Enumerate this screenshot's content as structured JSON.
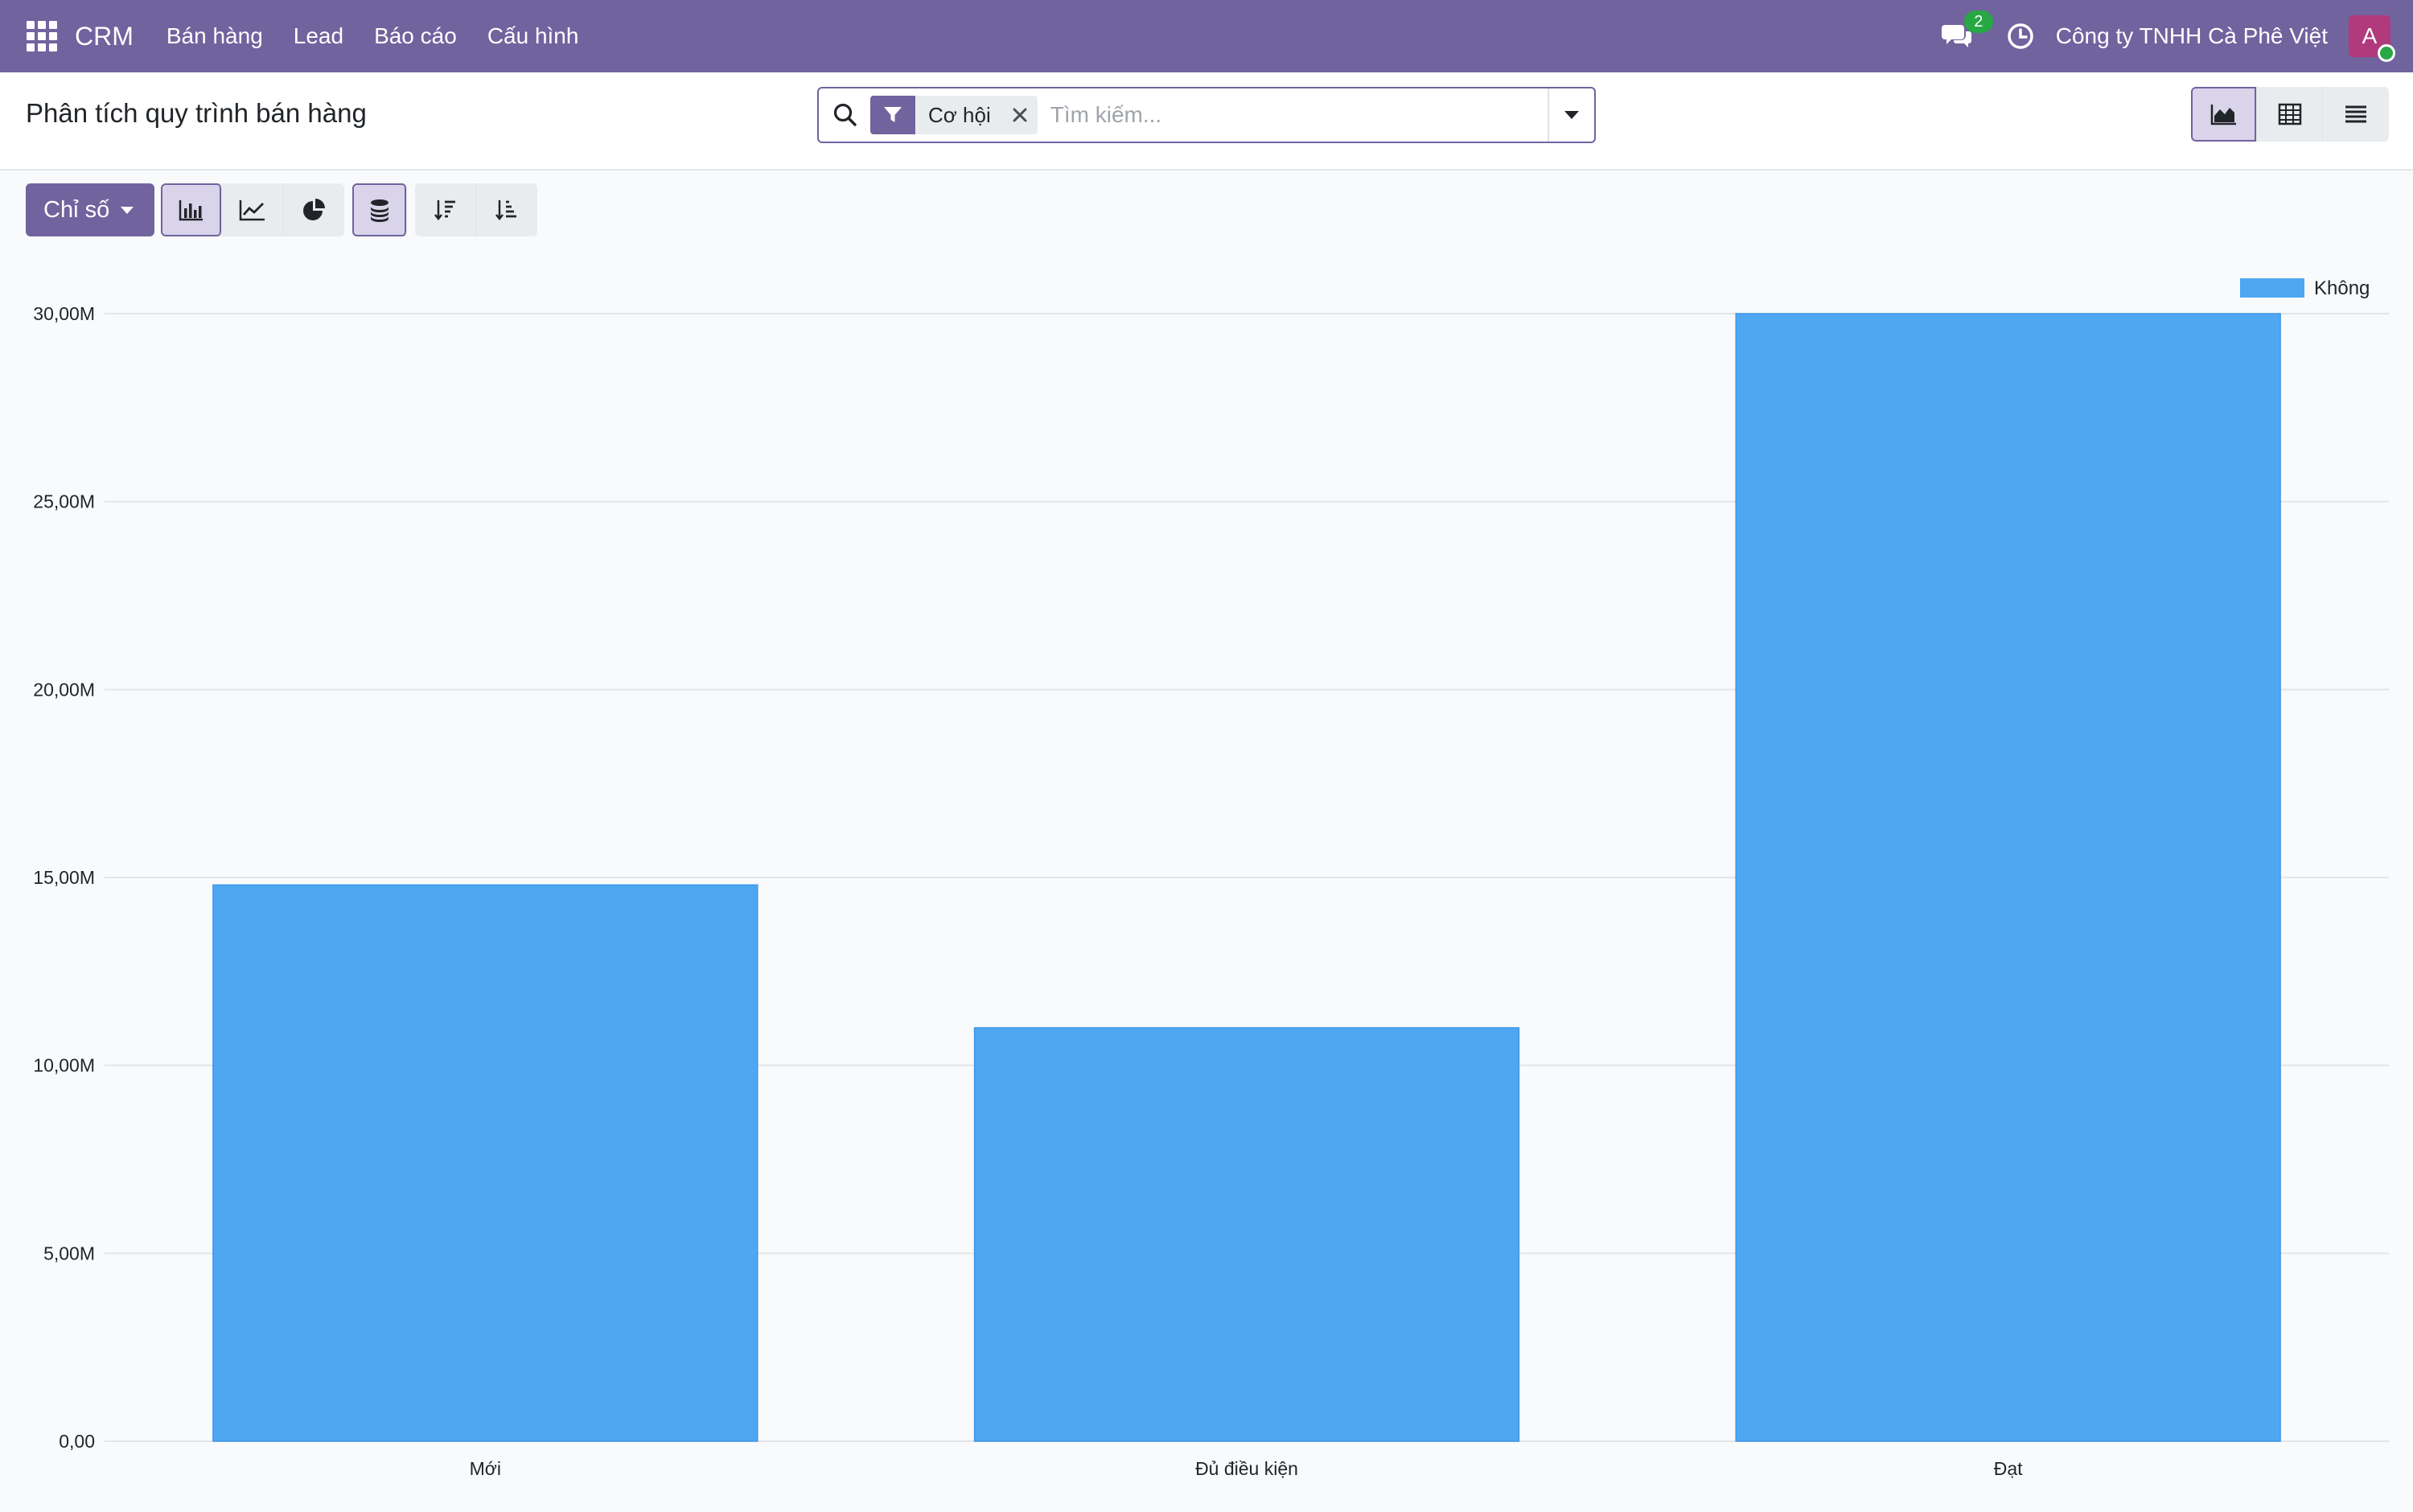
{
  "navbar": {
    "brand": "CRM",
    "menu": [
      "Bán hàng",
      "Lead",
      "Báo cáo",
      "Cấu hình"
    ],
    "chat_count": "2",
    "company": "Công ty TNHH Cà Phê Việt",
    "avatar_letter": "A"
  },
  "control_panel": {
    "title": "Phân tích quy trình bán hàng",
    "search": {
      "facet_label": "Cơ hội",
      "placeholder": "Tìm kiếm..."
    }
  },
  "toolbar": {
    "measures_label": "Chỉ số"
  },
  "icons": {
    "apps": "apps-grid-icon",
    "chat": "chat-icon",
    "clock": "clock-icon",
    "search": "search-icon",
    "filter": "filter-icon",
    "close": "close-icon",
    "caret": "caret-down-icon",
    "views": [
      "graph-view-icon",
      "pivot-view-icon",
      "list-view-icon"
    ],
    "tools": [
      "bar-chart-icon",
      "line-chart-icon",
      "pie-chart-icon",
      "stacked-icon",
      "sort-descending-icon",
      "sort-ascending-icon"
    ]
  },
  "colors": {
    "brand": "#71639e",
    "bar": "#4fa7f2",
    "badge": "#28a745"
  },
  "chart_data": {
    "type": "bar",
    "categories": [
      "Mới",
      "Đủ điều kiện",
      "Đạt"
    ],
    "series": [
      {
        "name": "Không",
        "values": [
          14800000,
          11000000,
          30000000
        ]
      }
    ],
    "ylim": [
      0,
      30000000
    ],
    "yticks": [
      0,
      5000000,
      10000000,
      15000000,
      20000000,
      25000000,
      30000000
    ],
    "ytick_labels": [
      "0,00",
      "5,00M",
      "10,00M",
      "15,00M",
      "20,00M",
      "25,00M",
      "30,00M"
    ],
    "grid": true,
    "legend_position": "top-right"
  }
}
